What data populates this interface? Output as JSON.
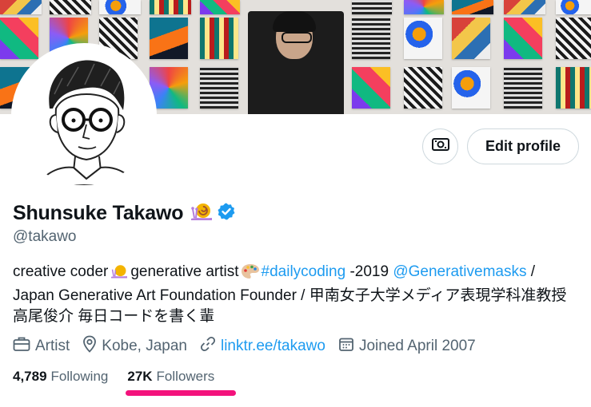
{
  "profile": {
    "display_name": "Shunsuke Takawo",
    "handle": "@takawo",
    "edit_profile_label": "Edit profile",
    "verified": true
  },
  "bio": {
    "part1": "creative coder",
    "part2": "generative artist",
    "hashtag": "#dailycoding",
    "part3": "-2019",
    "mention": "@Generativemasks",
    "part4": "/ Japan Generative Art Foundation Founder / 甲南女子大学メディア表現学科准教授 高尾俊介 毎日コードを書く輩"
  },
  "meta": {
    "category": "Artist",
    "location": "Kobe, Japan",
    "website": "linktr.ee/takawo",
    "joined": "Joined April 2007"
  },
  "stats": {
    "following_count": "4,789",
    "following_label": "Following",
    "followers_count": "27K",
    "followers_label": "Followers"
  },
  "icons": {
    "action_button": "money-icon",
    "name_emoji": "snail-icon",
    "badge": "verified-badge-icon",
    "bio_emoji_1": "snail-icon",
    "bio_emoji_2": "palette-icon",
    "category": "briefcase-icon",
    "location": "location-pin-icon",
    "website": "link-icon",
    "joined": "calendar-icon"
  },
  "colors": {
    "link": "#1d9bf0",
    "highlight_underline": "#f3127c",
    "secondary_text": "#536471",
    "primary_text": "#0f1419"
  }
}
